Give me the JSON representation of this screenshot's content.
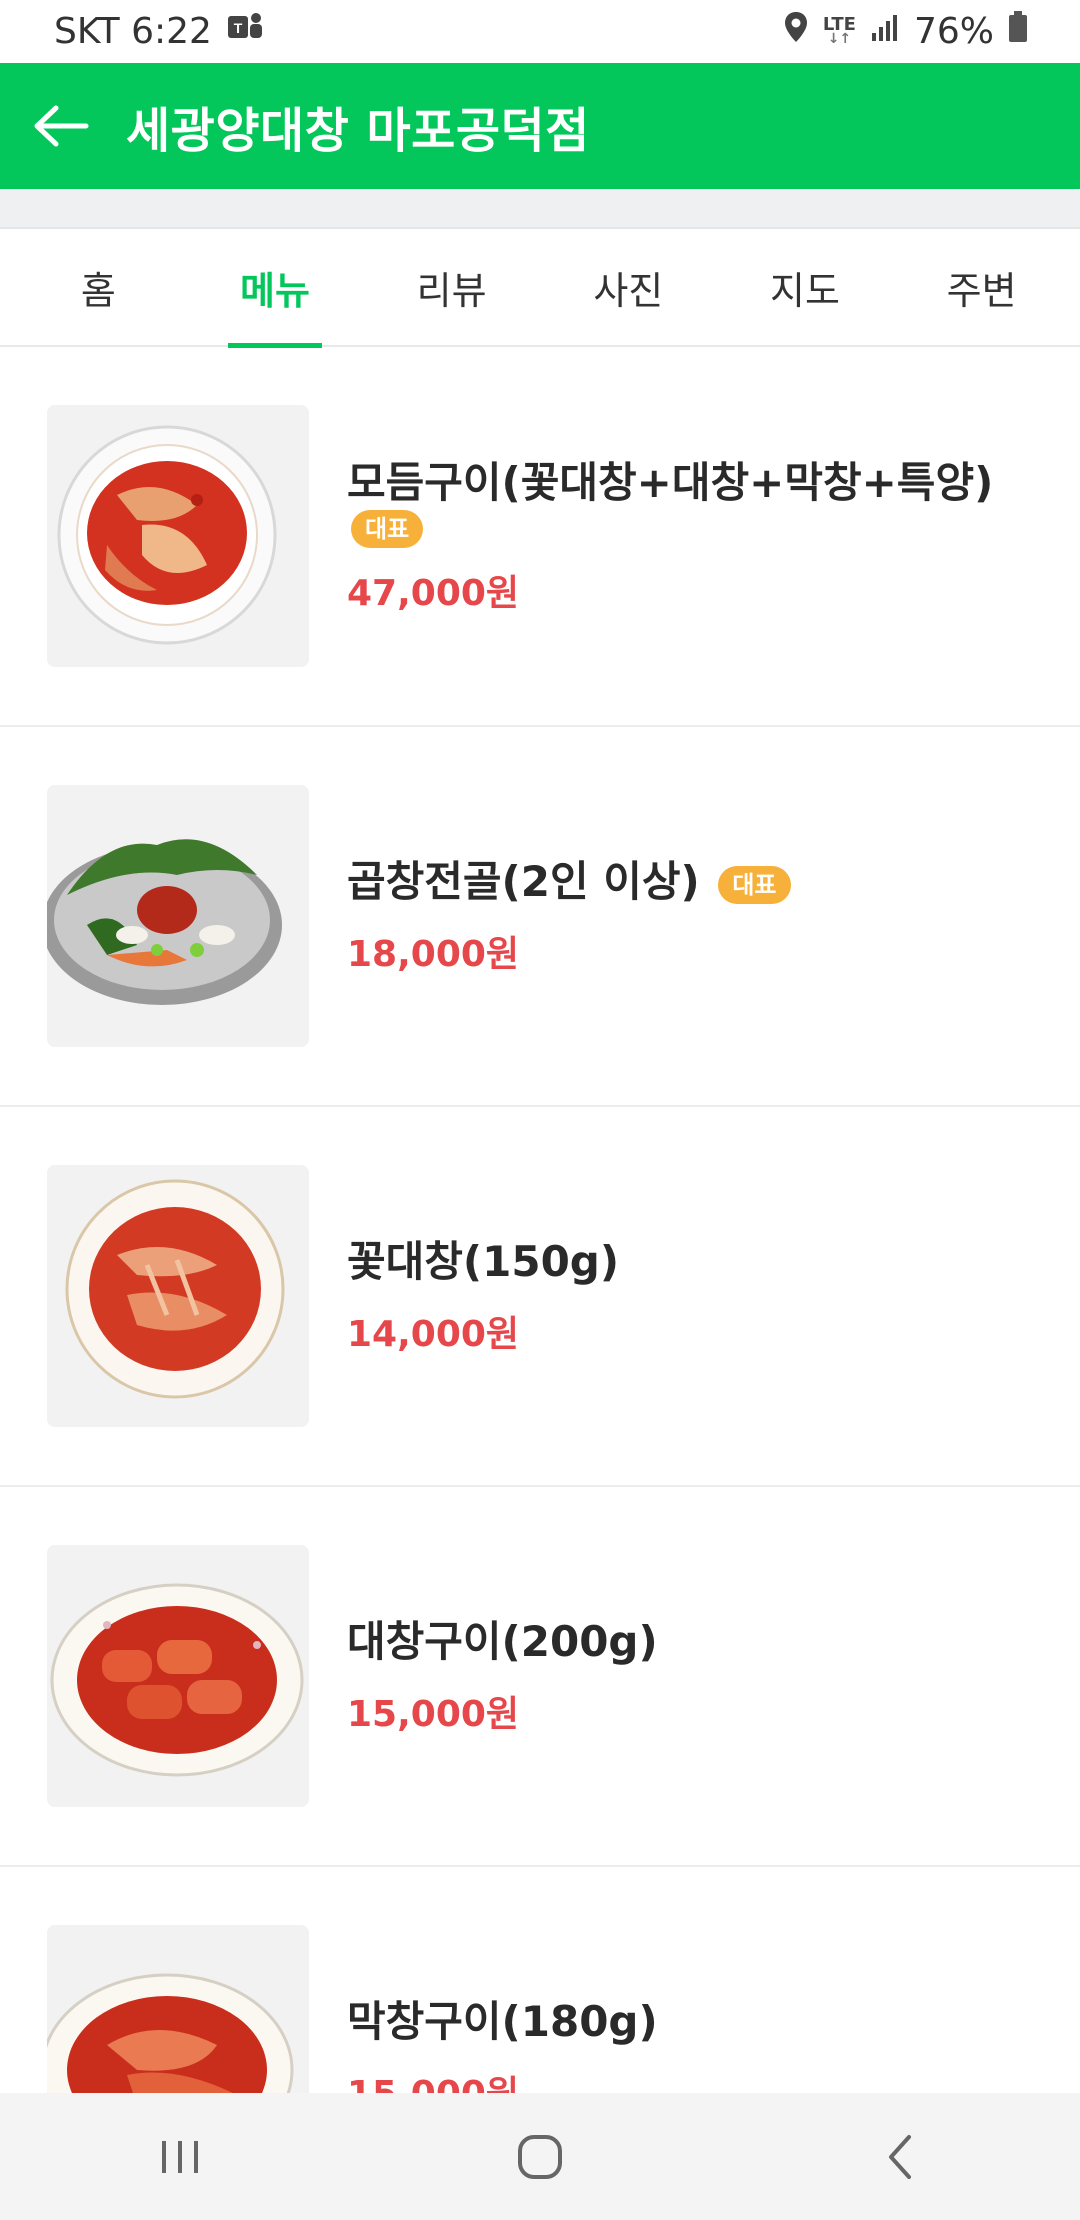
{
  "status_bar": {
    "carrier_time": "SKT 6:22",
    "network": "LTE",
    "battery": "76%"
  },
  "app_bar": {
    "title": "세광양대창 마포공덕점"
  },
  "tabs": [
    {
      "label": "홈",
      "active": false
    },
    {
      "label": "메뉴",
      "active": true
    },
    {
      "label": "리뷰",
      "active": false
    },
    {
      "label": "사진",
      "active": false
    },
    {
      "label": "지도",
      "active": false
    },
    {
      "label": "주변",
      "active": false
    }
  ],
  "menu": [
    {
      "name": "모듬구이(꽃대창+대창+막창+특양)",
      "badge": "대표",
      "price": "47,000원"
    },
    {
      "name": "곱창전골(2인 이상)",
      "badge": "대표",
      "price": "18,000원"
    },
    {
      "name": "꽃대창(150g)",
      "badge": "",
      "price": "14,000원"
    },
    {
      "name": "대창구이(200g)",
      "badge": "",
      "price": "15,000원"
    },
    {
      "name": "막창구이(180g)",
      "badge": "",
      "price": "15,000원"
    }
  ],
  "colors": {
    "brand": "#03c75a",
    "price": "#e5474b",
    "badge": "#f7b13a"
  }
}
